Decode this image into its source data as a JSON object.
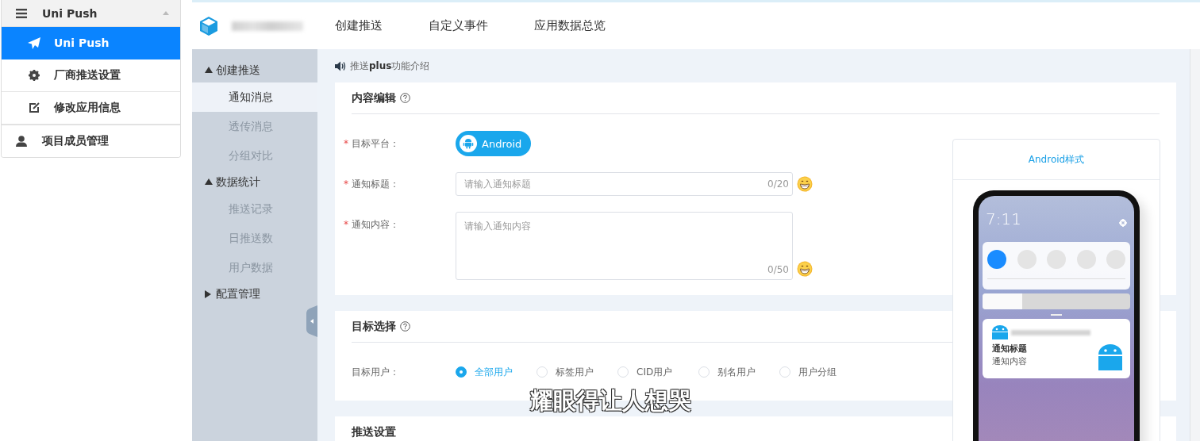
{
  "side_menu": [
    {
      "title": "Uni Push",
      "kind": "menu",
      "expanded": true,
      "items": [
        {
          "label": "Uni Push",
          "kind": "send",
          "selected": true
        },
        {
          "label": "厂商推送设置",
          "kind": "gear",
          "selected": false
        },
        {
          "label": "修改应用信息",
          "kind": "edit",
          "selected": false
        }
      ]
    },
    {
      "title": "项目成员管理",
      "kind": "user",
      "expanded": false
    }
  ],
  "top_nav": [
    {
      "label": "创建推送"
    },
    {
      "label": "自定义事件"
    },
    {
      "label": "应用数据总览"
    }
  ],
  "sub_nav": [
    {
      "label": "创建推送",
      "expanded": true,
      "children": [
        {
          "label": "通知消息",
          "selected": true
        },
        {
          "label": "透传消息",
          "selected": false
        },
        {
          "label": "分组对比",
          "selected": false
        }
      ]
    },
    {
      "label": "数据统计",
      "expanded": true,
      "children": [
        {
          "label": "推送记录",
          "selected": false
        },
        {
          "label": "日推送数",
          "selected": false
        },
        {
          "label": "用户数据",
          "selected": false
        }
      ]
    },
    {
      "label": "配置管理",
      "expanded": false
    }
  ],
  "announcement": "推送**plus**功能介绍",
  "content_card": {
    "title": "内容编辑",
    "fields": [
      {
        "kind": "platform",
        "marker": "*",
        "label": "目标平台：",
        "button": "Android"
      },
      {
        "kind": "input",
        "marker": "*",
        "label": "通知标题：",
        "placeholder": "请输入通知标题",
        "counter": "0/20"
      },
      {
        "kind": "textarea",
        "marker": "*",
        "label": "通知内容：",
        "placeholder": "请输入通知内容",
        "counter": "0/50"
      }
    ]
  },
  "preview": {
    "title": "Android样式",
    "time": "7:11",
    "brightness": {
      "level": 0.27
    },
    "notification_title": "通知标题",
    "notification_body": "通知内容"
  },
  "target_card": {
    "title": "目标选择",
    "label": "目标用户：",
    "options": [
      {
        "label": "全部用户",
        "selected": true
      },
      {
        "label": "标签用户",
        "selected": false
      },
      {
        "label": "CID用户",
        "selected": false
      },
      {
        "label": "别名用户",
        "selected": false
      },
      {
        "label": "用户分组",
        "selected": false
      }
    ]
  },
  "push_card": {
    "title": "推送设置"
  },
  "caption": "耀眼得让人想哭"
}
